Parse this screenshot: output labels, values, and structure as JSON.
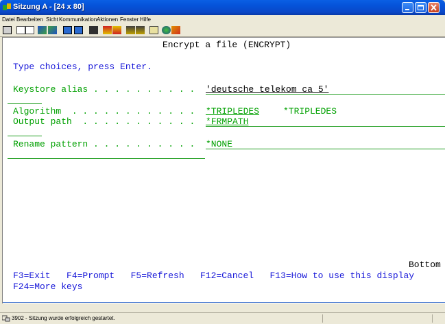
{
  "window": {
    "title": "Sitzung A - [24 x 80]"
  },
  "menu": [
    "Datei",
    "Bearbeiten",
    "Sicht",
    "Kommunikation",
    "Aktionen",
    "Fenster",
    "Hilfe"
  ],
  "toolbar": {
    "icons": [
      "screen-icon",
      "copy-icon",
      "paste-icon",
      "send-icon",
      "receive-icon",
      "display-icon",
      "keyboard-icon",
      "macro-icon",
      "record-icon",
      "stop-icon",
      "play-icon",
      "options-icon",
      "clipboard-icon",
      "globe-icon",
      "edit-icon"
    ]
  },
  "screen": {
    "title": "Encrypt a file (ENCRYPT)",
    "instructions": "Type choices, press Enter.",
    "fields": {
      "keystore_label": "Keystore alias . . . . . . . . . .",
      "keystore_value": "'deutsche telekom ca 5'",
      "algorithm_label": "Algorithm  . . . . . . . . . . . .",
      "algorithm_value": "*TRIPLEDES",
      "algorithm_choices": "*TRIPLEDES",
      "output_label": "Output path  . . . . . . . . . . .",
      "output_value": "*FRMPATH",
      "rename_label": "Rename pattern . . . . . . . . . .",
      "rename_value": "*NONE"
    },
    "bottom": "Bottom",
    "fkeys_line1": "F3=Exit   F4=Prompt   F5=Refresh   F12=Cancel   F13=How to use this display",
    "fkeys_line2": "F24=More keys"
  },
  "status": {
    "text": "3902 - Sitzung wurde erfolgreich gestartet."
  },
  "colors": {
    "prompt_text": "#00a000",
    "title_text": "#000000",
    "instruction_text": "#1515d8"
  }
}
